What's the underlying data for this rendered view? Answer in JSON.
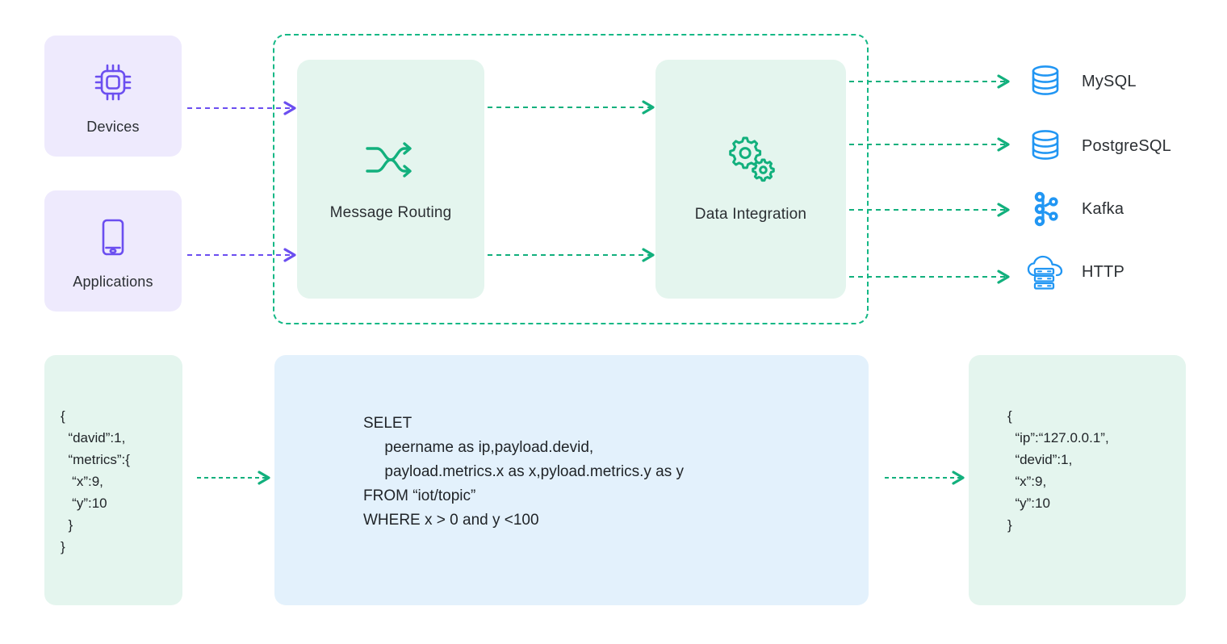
{
  "theme": {
    "source_fill": "#eeeafd",
    "source_accent": "#6b4ef0",
    "process_fill": "#e4f5ee",
    "process_accent": "#12b07d",
    "sink_accent": "#2196f3",
    "sql_fill": "#e3f1fc",
    "text": "#2b2f33",
    "dashed_border": "#15b886"
  },
  "sources": [
    {
      "label": "Devices",
      "icon": "chip-icon"
    },
    {
      "label": "Applications",
      "icon": "mobile-device-icon"
    }
  ],
  "engine": {
    "container_label": "processing-pipeline",
    "stages": [
      {
        "label": "Message Routing",
        "icon": "shuffle-routing-icon"
      },
      {
        "label": "Data Integration",
        "icon": "gears-icon"
      }
    ]
  },
  "sinks": [
    {
      "label": "MySQL",
      "icon": "database-cylinder-icon"
    },
    {
      "label": "PostgreSQL",
      "icon": "database-cylinder-icon"
    },
    {
      "label": "Kafka",
      "icon": "kafka-nodes-icon"
    },
    {
      "label": "HTTP",
      "icon": "cloud-server-icon"
    }
  ],
  "example": {
    "input_payload": "{\n  “david”:1,\n  “metrics”:{\n   “x”:9,\n   “y”:10\n  }\n}",
    "sql_rule": "SELET\n     peername as ip,payload.devid,\n     payload.metrics.x as x,pyload.metrics.y as y\nFROM “iot/topic”\nWHERE x > 0 and y <100",
    "output_payload": "{\n  “ip”:“127.0.0.1”,\n  “devid”:1,\n  “x”:9,\n  “y”:10\n}"
  }
}
